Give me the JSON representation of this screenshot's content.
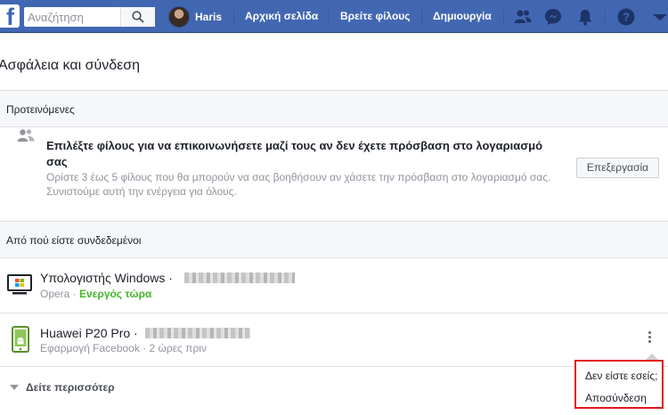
{
  "topbar": {
    "logo_letter": "f",
    "search_placeholder": "Αναζήτηση",
    "user_name": "Haris",
    "nav_links": [
      "Αρχική σελίδα",
      "Βρείτε φίλους",
      "Δημιουργία"
    ],
    "icons": [
      "friends-icon",
      "messenger-icon",
      "notifications-icon",
      "help-icon",
      "dropdown-icon"
    ],
    "brand_color": "#4267b2"
  },
  "page": {
    "title": "Ασφάλεια και σύνδεση"
  },
  "recommended": {
    "header": "Προτεινόμενες",
    "title": "Επιλέξτε φίλους για να επικοινωνήσετε μαζί τους αν δεν έχετε πρόσβαση στο λογαριασμό σας",
    "description": "Ορίστε 3 έως 5 φίλους που θα μπορούν να σας βοηθήσουν αν χάσετε την πρόσβαση στο λογαριασμό σας. Συνιστούμε αυτή την ενέργεια για όλους.",
    "edit_label": "Επεξεργασία"
  },
  "sessions": {
    "header": "Από πού είστε συνδεδεμένοι",
    "devices": [
      {
        "name": "Υπολογιστής Windows ·",
        "app": "Opera ·",
        "status": "Ενεργός τώρα",
        "icon": "windows-computer-icon"
      },
      {
        "name": "Huawei P20 Pro ·",
        "app": "Εφαρμογή Facebook · 2 ώρες πριν",
        "icon": "android-phone-icon"
      }
    ],
    "see_more": "Δείτε περισσότερ",
    "menu": {
      "not_you": "Δεν είστε εσείς;",
      "logout": "Αποσύνδεση",
      "highlight_color": "#e0181e"
    }
  }
}
